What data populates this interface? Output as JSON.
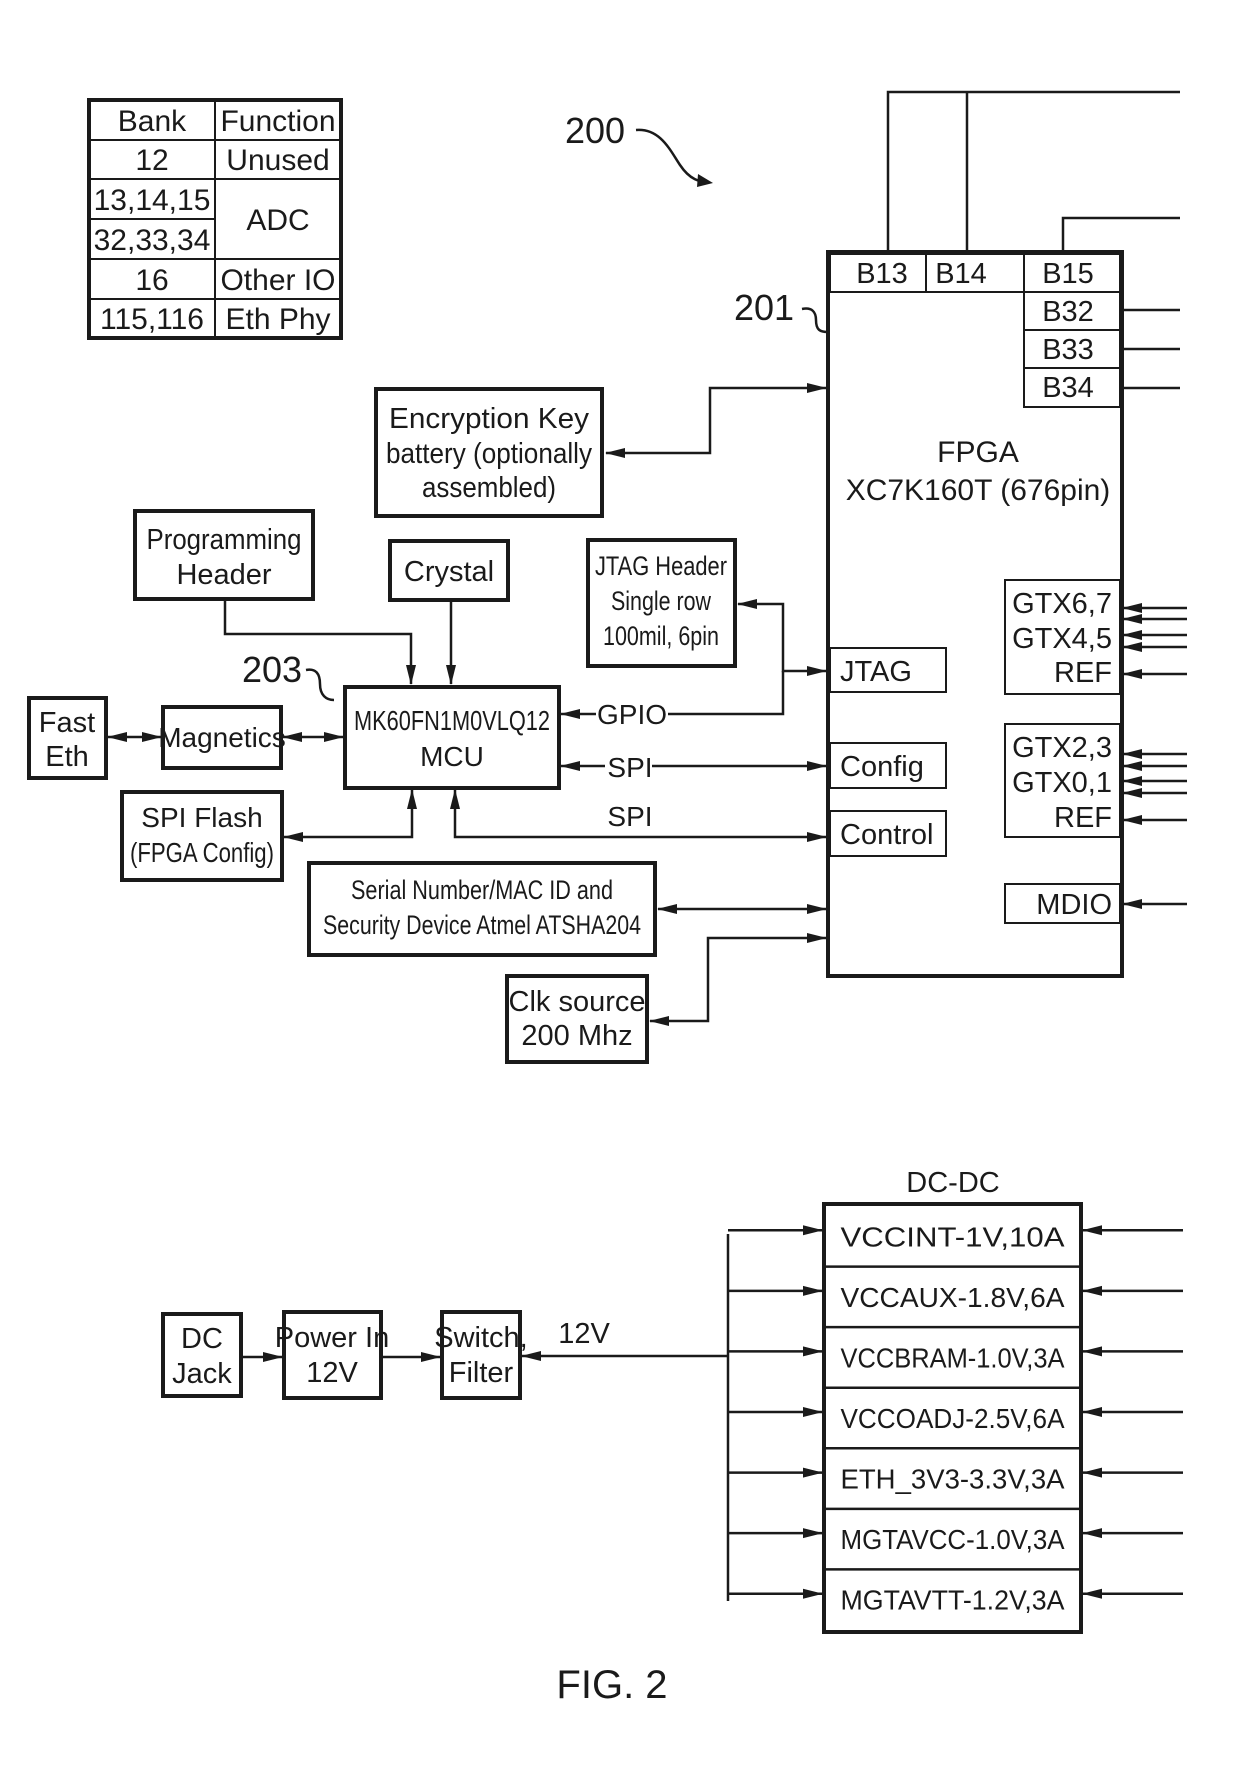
{
  "figure": {
    "caption": "FIG. 2",
    "ref_system": "200",
    "ref_fpga": "201",
    "ref_mcu": "203"
  },
  "bank_table": {
    "headers": [
      "Bank",
      "Function"
    ],
    "rows": [
      {
        "bank": "12",
        "function": "Unused"
      },
      {
        "bank": "13,14,15",
        "function": "ADC"
      },
      {
        "bank": "32,33,34",
        "function": "ADC"
      },
      {
        "bank": "16",
        "function": "Other IO"
      },
      {
        "bank": "115,116",
        "function": "Eth Phy"
      }
    ]
  },
  "fpga": {
    "title_line1": "FPGA",
    "title_line2": "XC7K160T (676pin)",
    "banks_top": [
      "B13",
      "B14",
      "B15"
    ],
    "banks_right": [
      "B32",
      "B33",
      "B34"
    ],
    "left_ports": [
      "JTAG",
      "Config",
      "Control"
    ],
    "gtx_group_1": [
      "GTX6,7",
      "GTX4,5",
      "REF"
    ],
    "gtx_group_2": [
      "GTX2,3",
      "GTX0,1",
      "REF"
    ],
    "mdio": "MDIO"
  },
  "mcu": {
    "line1": "MK60FN1M0VLQ12",
    "line2": "MCU"
  },
  "blocks": {
    "encryption_key": [
      "Encryption Key",
      "battery (optionally",
      "assembled)"
    ],
    "programming_header": [
      "Programming",
      "Header"
    ],
    "crystal": [
      "Crystal"
    ],
    "jtag_header": [
      "JTAG Header",
      "Single row",
      "100mil, 6pin"
    ],
    "fast_eth": [
      "Fast",
      "Eth"
    ],
    "magnetics": [
      "Magnetics"
    ],
    "spi_flash": [
      "SPI Flash",
      "(FPGA Config)"
    ],
    "serial_number": [
      "Serial Number/MAC ID and",
      "Security Device Atmel ATSHA204"
    ],
    "clk_source": [
      "Clk source",
      "200 Mhz"
    ]
  },
  "signals": {
    "gpio": "GPIO",
    "spi_config": "SPI",
    "spi_control": "SPI",
    "power_12v": "12V"
  },
  "power": {
    "dc_jack": [
      "DC",
      "Jack"
    ],
    "power_in": [
      "Power In",
      "12V"
    ],
    "switch_filter": [
      "Switch,",
      "Filter"
    ],
    "dcdc_title": "DC-DC",
    "rails": [
      "VCCINT-1V,10A",
      "VCCAUX-1.8V,6A",
      "VCCBRAM-1.0V,3A",
      "VCCOADJ-2.5V,6A",
      "ETH_3V3-3.3V,3A",
      "MGTAVCC-1.0V,3A",
      "MGTAVTT-1.2V,3A"
    ]
  }
}
